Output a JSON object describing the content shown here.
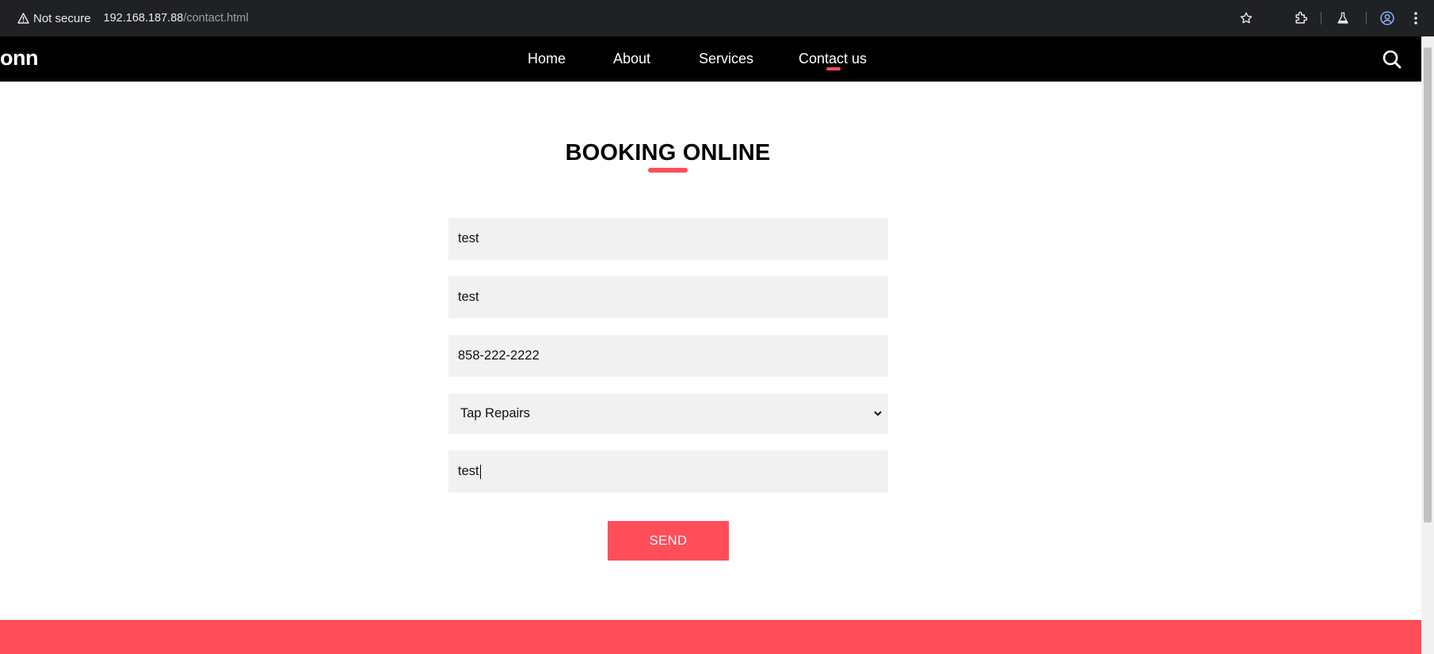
{
  "browser": {
    "security_label": "Not secure",
    "url_host": "192.168.187.88",
    "url_path": "/contact.html"
  },
  "header": {
    "brand": "onn",
    "nav": [
      {
        "label": "Home",
        "active": false
      },
      {
        "label": "About",
        "active": false
      },
      {
        "label": "Services",
        "active": false
      },
      {
        "label": "Contact us",
        "active": true
      }
    ],
    "search_icon": "search-icon"
  },
  "booking": {
    "title": "BOOKING ONLINE",
    "fields": {
      "field1_value": "test",
      "field2_value": "test",
      "phone_value": "858-222-2222",
      "service_selected": "Tap Repairs",
      "message_value": "test"
    },
    "send_label": "SEND"
  },
  "colors": {
    "accent": "#ff4d5a",
    "header_bg": "#000000",
    "field_bg": "#f1f1f1"
  }
}
